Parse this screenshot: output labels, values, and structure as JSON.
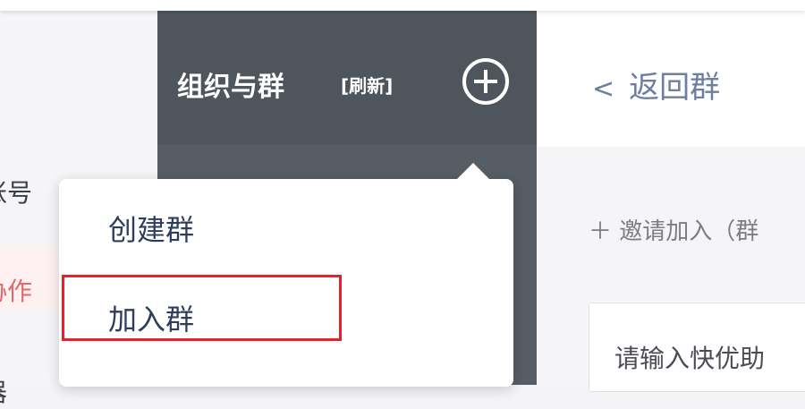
{
  "left_nav": {
    "items": [
      {
        "label": "账号"
      },
      {
        "label": "协作"
      },
      {
        "label": "器"
      }
    ]
  },
  "org_panel": {
    "title": "组织与群",
    "refresh_label": "[刷新]",
    "add_icon": "plus-circle-icon"
  },
  "right_panel": {
    "back_label": "返回群",
    "back_icon": "chevron-left-icon",
    "invite_label": "＋ 邀请加入（群",
    "search_placeholder": "请输入快优助"
  },
  "dropdown": {
    "items": [
      {
        "label": "创建群"
      },
      {
        "label": "加入群",
        "highlighted": true
      }
    ]
  },
  "colors": {
    "dark_panel": "#575d65",
    "menu_text": "#2f3d5c",
    "highlight_border": "#e8202a",
    "collab_text": "#e06a70",
    "back_link": "#6c7fa1"
  }
}
